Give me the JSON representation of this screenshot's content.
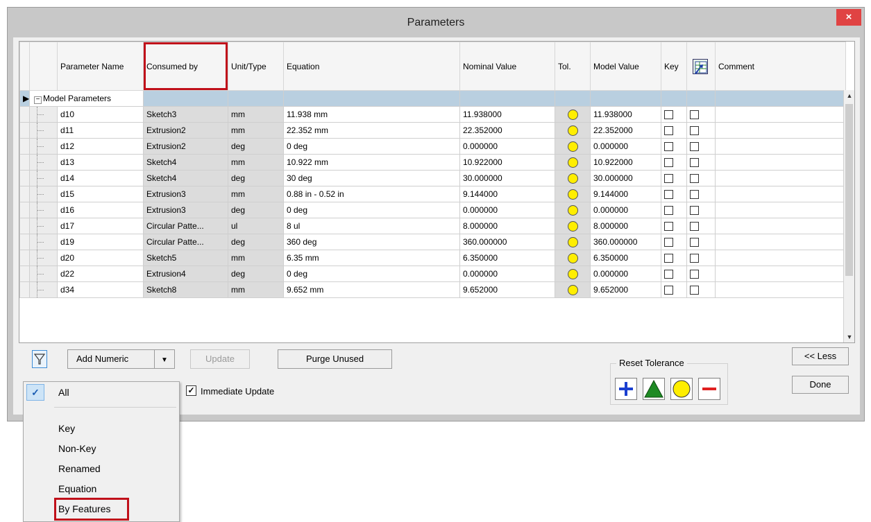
{
  "window": {
    "title": "Parameters",
    "close_label": "×"
  },
  "columns": {
    "parameter_name": "Parameter Name",
    "consumed_by": "Consumed by",
    "unit_type": "Unit/Type",
    "equation": "Equation",
    "nominal_value": "Nominal Value",
    "tol": "Tol.",
    "model_value": "Model Value",
    "key": "Key",
    "comment": "Comment"
  },
  "group": {
    "expander": "−",
    "label": "Model Parameters"
  },
  "rows": [
    {
      "name": "d10",
      "consumed_by": "Sketch3",
      "unit": "mm",
      "equation": "11.938 mm",
      "nominal": "11.938000",
      "model": "11.938000"
    },
    {
      "name": "d11",
      "consumed_by": "Extrusion2",
      "unit": "mm",
      "equation": "22.352 mm",
      "nominal": "22.352000",
      "model": "22.352000"
    },
    {
      "name": "d12",
      "consumed_by": "Extrusion2",
      "unit": "deg",
      "equation": "0 deg",
      "nominal": "0.000000",
      "model": "0.000000"
    },
    {
      "name": "d13",
      "consumed_by": "Sketch4",
      "unit": "mm",
      "equation": "10.922 mm",
      "nominal": "10.922000",
      "model": "10.922000"
    },
    {
      "name": "d14",
      "consumed_by": "Sketch4",
      "unit": "deg",
      "equation": "30 deg",
      "nominal": "30.000000",
      "model": "30.000000"
    },
    {
      "name": "d15",
      "consumed_by": "Extrusion3",
      "unit": "mm",
      "equation": "0.88 in - 0.52 in",
      "nominal": "9.144000",
      "model": "9.144000"
    },
    {
      "name": "d16",
      "consumed_by": "Extrusion3",
      "unit": "deg",
      "equation": "0 deg",
      "nominal": "0.000000",
      "model": "0.000000"
    },
    {
      "name": "d17",
      "consumed_by": "Circular Patte...",
      "unit": "ul",
      "equation": "8 ul",
      "nominal": "8.000000",
      "model": "8.000000"
    },
    {
      "name": "d19",
      "consumed_by": "Circular Patte...",
      "unit": "deg",
      "equation": "360 deg",
      "nominal": "360.000000",
      "model": "360.000000"
    },
    {
      "name": "d20",
      "consumed_by": "Sketch5",
      "unit": "mm",
      "equation": "6.35 mm",
      "nominal": "6.350000",
      "model": "6.350000"
    },
    {
      "name": "d22",
      "consumed_by": "Extrusion4",
      "unit": "deg",
      "equation": "0 deg",
      "nominal": "0.000000",
      "model": "0.000000"
    },
    {
      "name": "d34",
      "consumed_by": "Sketch8",
      "unit": "mm",
      "equation": "9.652 mm",
      "nominal": "9.652000",
      "model": "9.652000"
    }
  ],
  "toolbar": {
    "add_numeric": "Add Numeric",
    "update": "Update",
    "purge_unused": "Purge Unused",
    "immediate_update": "Immediate Update",
    "less": "<< Less",
    "done": "Done"
  },
  "reset_tolerance": {
    "label": "Reset Tolerance"
  },
  "filter_menu": {
    "items": [
      "All",
      "Key",
      "Non-Key",
      "Renamed",
      "Equation",
      "By Features"
    ],
    "selected": "All"
  },
  "colors": {
    "highlight": "#c0101a",
    "tolerance_dot": "#ffee00",
    "group_row": "#b9cfe0",
    "accent": "#3b8bd6"
  }
}
